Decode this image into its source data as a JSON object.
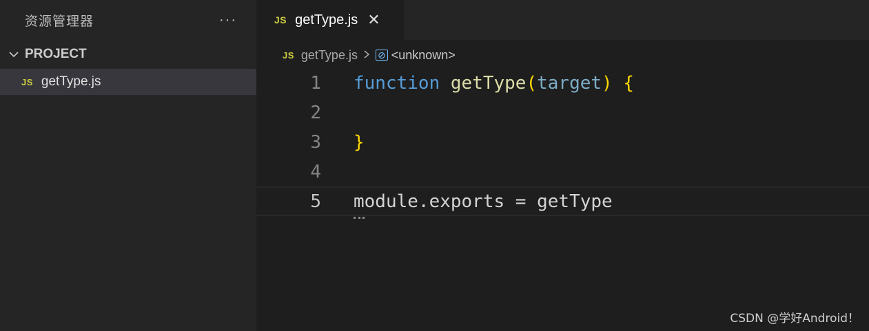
{
  "sidebar": {
    "title": "资源管理器",
    "more": "···",
    "project_label": "PROJECT",
    "files": [
      {
        "icon": "JS",
        "name": "getType.js"
      }
    ]
  },
  "tab": {
    "icon": "JS",
    "label": "getType.js",
    "close": "✕"
  },
  "breadcrumb": {
    "icon": "JS",
    "file": "getType.js",
    "separator": ">",
    "symbol_icon": "⊘",
    "symbol": "<unknown>"
  },
  "code": {
    "line_numbers": [
      "1",
      "2",
      "3",
      "4",
      "5"
    ],
    "line1": {
      "kw": "function",
      "fn": "getType",
      "open": "(",
      "param": "target",
      "close": ")",
      "brace": "{"
    },
    "line3": {
      "brace": "}"
    },
    "line5": {
      "text": "module.exports = getType"
    }
  },
  "watermark": "CSDN @学好Android！",
  "colors": {
    "keyword": "#569cd6",
    "function": "#dcdcaa",
    "bracket": "#ffd700",
    "js_icon": "#cbcb41"
  }
}
